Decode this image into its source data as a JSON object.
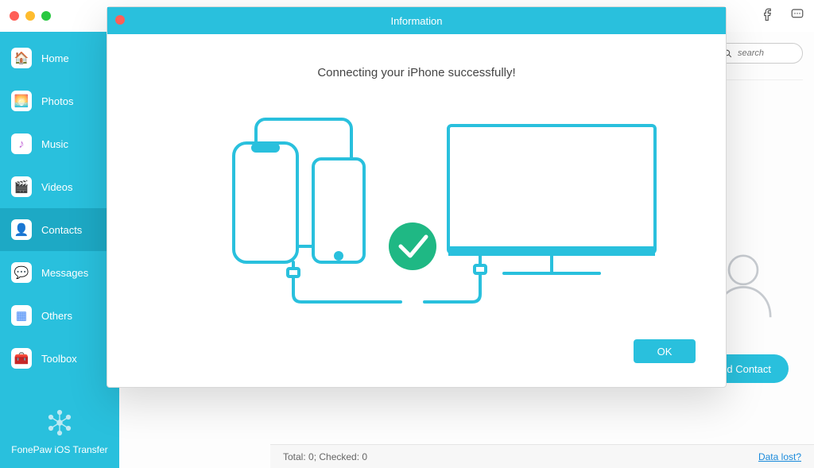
{
  "app": {
    "brand": "FonePaw iOS Transfer"
  },
  "sidebar": {
    "items": [
      {
        "label": "Home",
        "icon": "🏠",
        "iconColor": "#f6a623"
      },
      {
        "label": "Photos",
        "icon": "🌅",
        "iconColor": "#ff7a59"
      },
      {
        "label": "Music",
        "icon": "♪",
        "iconColor": "#c36bd8"
      },
      {
        "label": "Videos",
        "icon": "🎬",
        "iconColor": "#4aa3df"
      },
      {
        "label": "Contacts",
        "icon": "👤",
        "iconColor": "#9aa0a6"
      },
      {
        "label": "Messages",
        "icon": "💬",
        "iconColor": "#34c759"
      },
      {
        "label": "Others",
        "icon": "▦",
        "iconColor": "#3b82f6"
      },
      {
        "label": "Toolbox",
        "icon": "🧰",
        "iconColor": "#9aa0a6"
      }
    ],
    "activeIndex": 4
  },
  "search": {
    "placeholder": "search"
  },
  "content": {
    "addContact": "Add Contact"
  },
  "statusbar": {
    "left": "Total: 0; Checked: 0",
    "right": "Data lost?"
  },
  "modal": {
    "title": "Information",
    "message": "Connecting your iPhone successfully!",
    "ok": "OK"
  }
}
